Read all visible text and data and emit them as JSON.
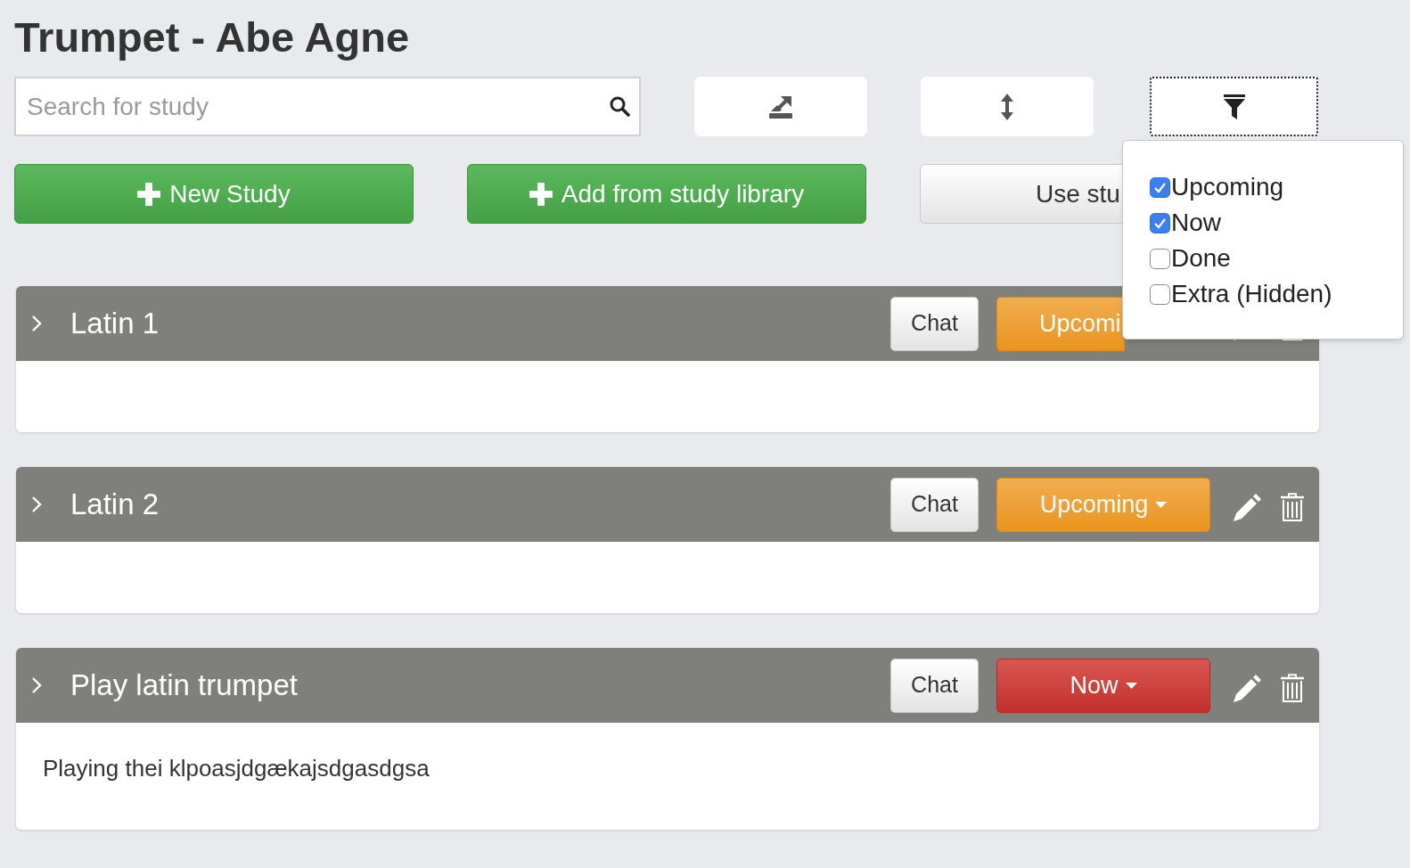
{
  "title": "Trumpet - Abe Agne",
  "search": {
    "placeholder": "Search for study"
  },
  "filter_menu": {
    "open": true,
    "options": [
      {
        "label": "Upcoming",
        "checked": true
      },
      {
        "label": "Now",
        "checked": true
      },
      {
        "label": "Done",
        "checked": false
      },
      {
        "label": "Extra (Hidden)",
        "checked": false
      }
    ]
  },
  "actions": [
    {
      "label": "New Study",
      "kind": "add",
      "covered": false
    },
    {
      "label": "Add from study library",
      "kind": "add",
      "covered": false
    },
    {
      "label": "Use stu",
      "kind": "plain",
      "covered": true
    }
  ],
  "cards": [
    {
      "title": "Latin 1",
      "chat": "Chat",
      "status": {
        "label": "Upcomi",
        "kind": "upcoming",
        "covered": true
      }
    },
    {
      "title": "Latin 2",
      "chat": "Chat",
      "status": {
        "label": "Upcoming",
        "kind": "upcoming",
        "covered": false
      }
    },
    {
      "title": "Play latin trumpet",
      "chat": "Chat",
      "status": {
        "label": "Now",
        "kind": "now",
        "covered": false
      },
      "description": "Playing thei klpoasjdgækajsdgasdgsa"
    }
  ]
}
